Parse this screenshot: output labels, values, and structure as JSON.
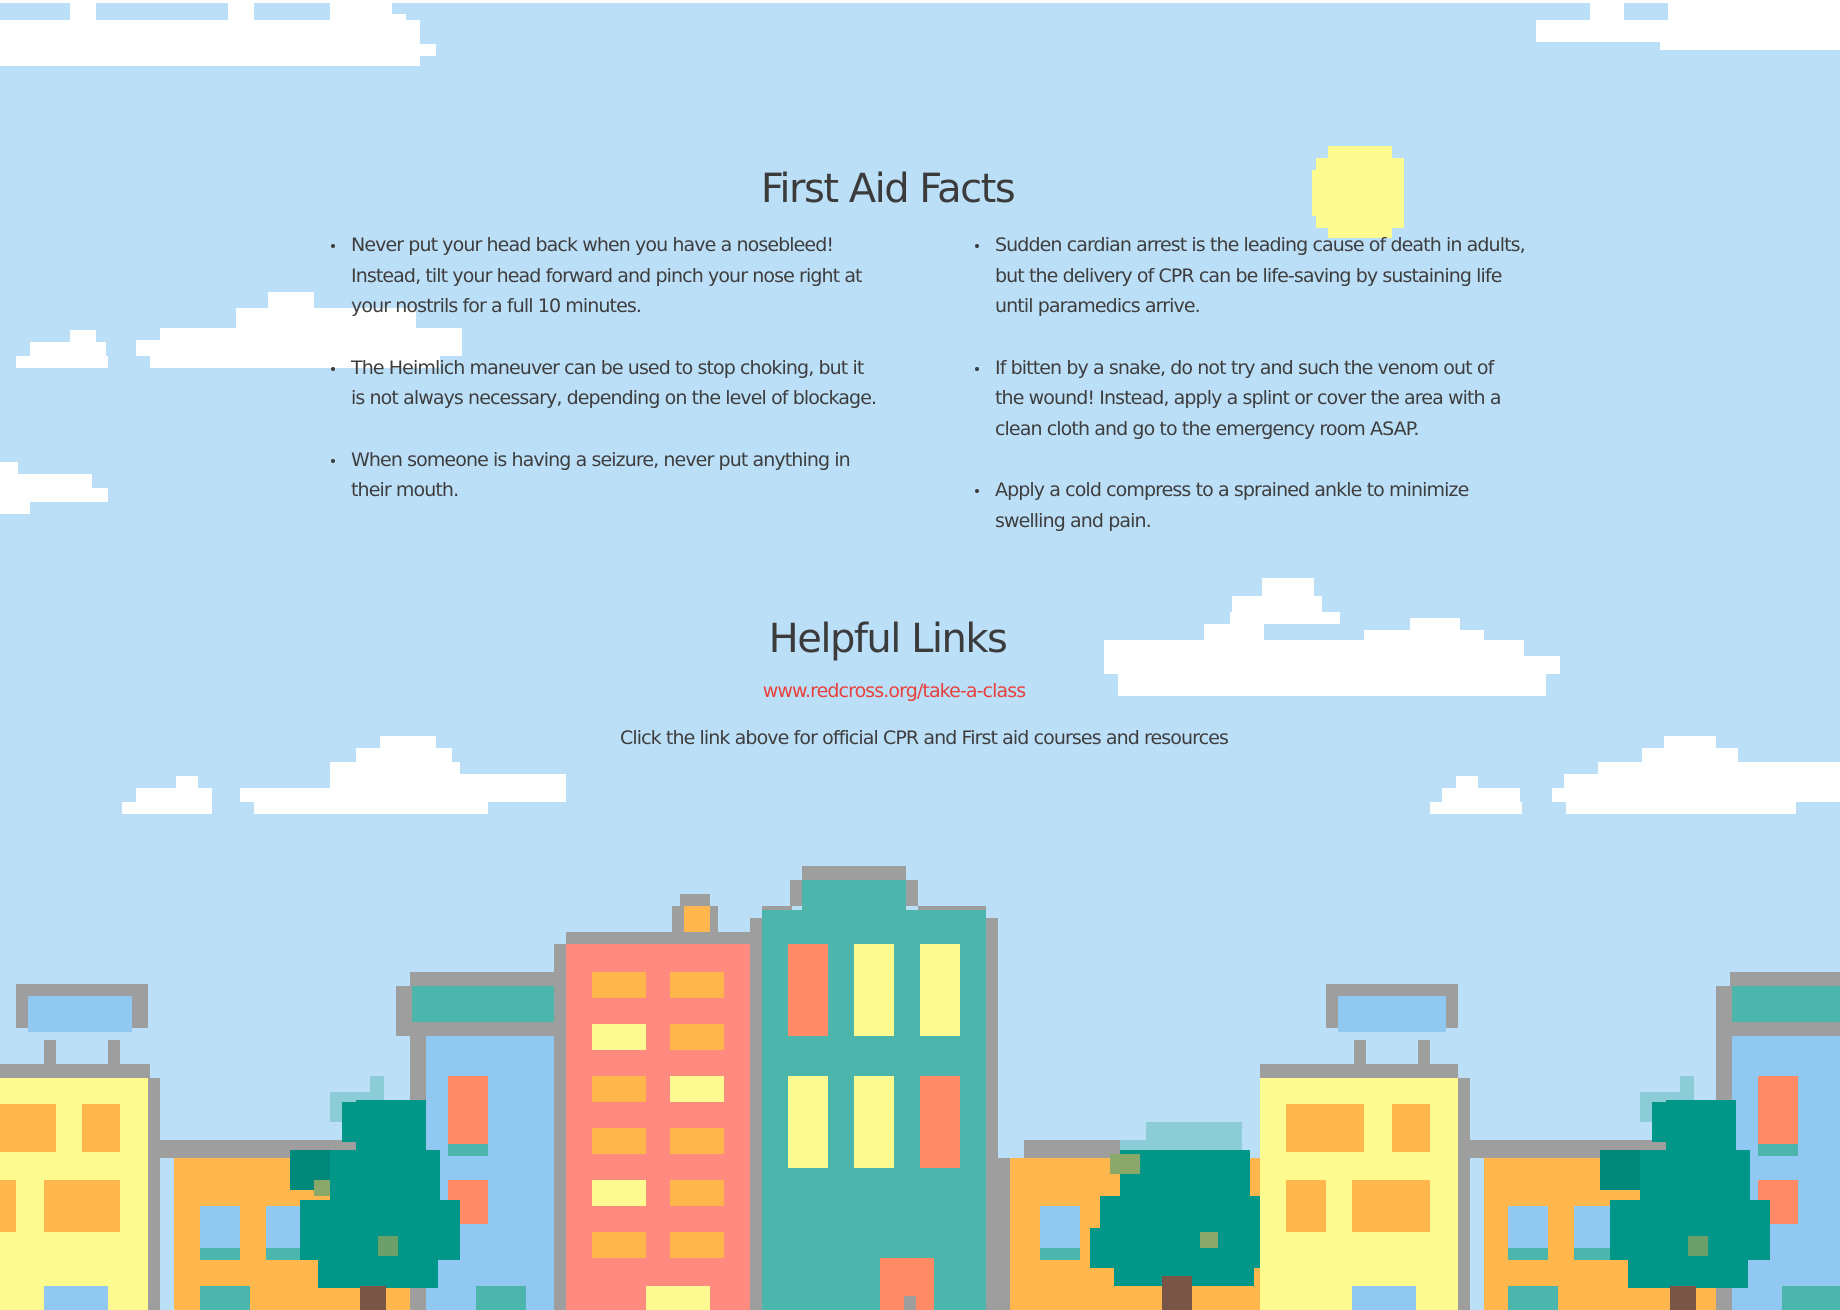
{
  "facts": {
    "title": "First Aid Facts",
    "left": [
      "Never put your head back when you have a nosebleed! Instead, tilt your head forward and pinch your nose right at your nostrils for a full 10 minutes.",
      "The Heimlich maneuver can be used to stop choking, but it is not always necessary, depending on the level of blockage.",
      "When someone is having a seizure, never put anything in their mouth."
    ],
    "right": [
      "Sudden cardian arrest is the leading cause of death in adults, but the delivery of CPR can be life-saving by sustaining life until paramedics arrive.",
      "If bitten by a snake, do not try and such the venom out of the wound! Instead, apply a splint or cover the area with a clean cloth and go to the emergency room ASAP.",
      "Apply a cold compress to a sprained ankle to minimize swelling and pain."
    ]
  },
  "links": {
    "title": "Helpful Links",
    "url_text": "www.redcross.org/take-a-class",
    "description": "Click the link above for official CPR and First aid courses and resources"
  },
  "colors": {
    "sky": "#bcdff8",
    "cloud": "#ffffff",
    "sun": "#fdfb8f",
    "link": "#e8403a",
    "text": "#3d3d3d"
  }
}
